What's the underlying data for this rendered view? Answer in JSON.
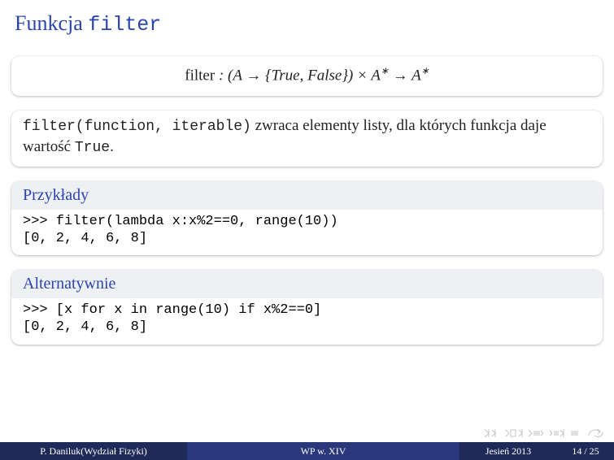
{
  "title": {
    "prefix": "Funkcja ",
    "mono": "filter"
  },
  "formula": "filter : (A → {True, False}) × A* → A*",
  "desc": {
    "mono": "filter(function, iterable)",
    "text1": " zwraca elementy listy, dla których funkcja daje wartość ",
    "mono2": "True",
    "text2": "."
  },
  "examples": {
    "header": "Przykłady",
    "code": ">>> filter(lambda x:x%2==0, range(10))\n[0, 2, 4, 6, 8]"
  },
  "alt": {
    "header": "Alternatywnie",
    "code": ">>> [x for x in range(10) if x%2==0]\n[0, 2, 4, 6, 8]"
  },
  "footer": {
    "author": "P. Daniluk(Wydział Fizyki)",
    "mid": "WP w. XIV",
    "date": "Jesień 2013",
    "page": "14 / 25"
  }
}
